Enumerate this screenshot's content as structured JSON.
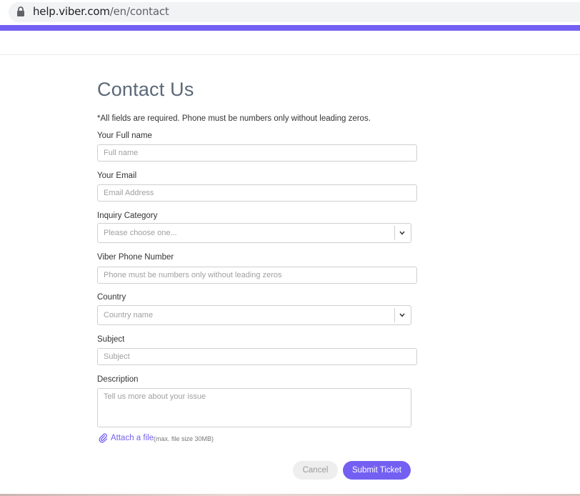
{
  "browser": {
    "url_domain": "help.viber.com",
    "url_path": "/en/contact"
  },
  "brand": {
    "accent": "#7360f2"
  },
  "form": {
    "title": "Contact Us",
    "note": "*All fields are required. Phone must be numbers only without leading zeros.",
    "full_name": {
      "label": "Your Full name",
      "placeholder": "Full name"
    },
    "email": {
      "label": "Your Email",
      "placeholder": "Email Address"
    },
    "category": {
      "label": "Inquiry Category",
      "placeholder": "Please choose one..."
    },
    "phone": {
      "label": "Viber Phone Number",
      "placeholder": "Phone must be numbers only without leading zeros"
    },
    "country": {
      "label": "Country",
      "placeholder": "Country name"
    },
    "subject": {
      "label": "Subject",
      "placeholder": "Subject"
    },
    "description": {
      "label": "Description",
      "placeholder": "Tell us more about your issue"
    },
    "attach": {
      "link": "Attach a file",
      "note": "(max. file size 30MB)"
    },
    "buttons": {
      "cancel": "Cancel",
      "submit": "Submit Ticket"
    }
  },
  "icons": {
    "lock": "lock-icon",
    "chevron": "chevron-down-icon",
    "paperclip": "paperclip-icon"
  }
}
